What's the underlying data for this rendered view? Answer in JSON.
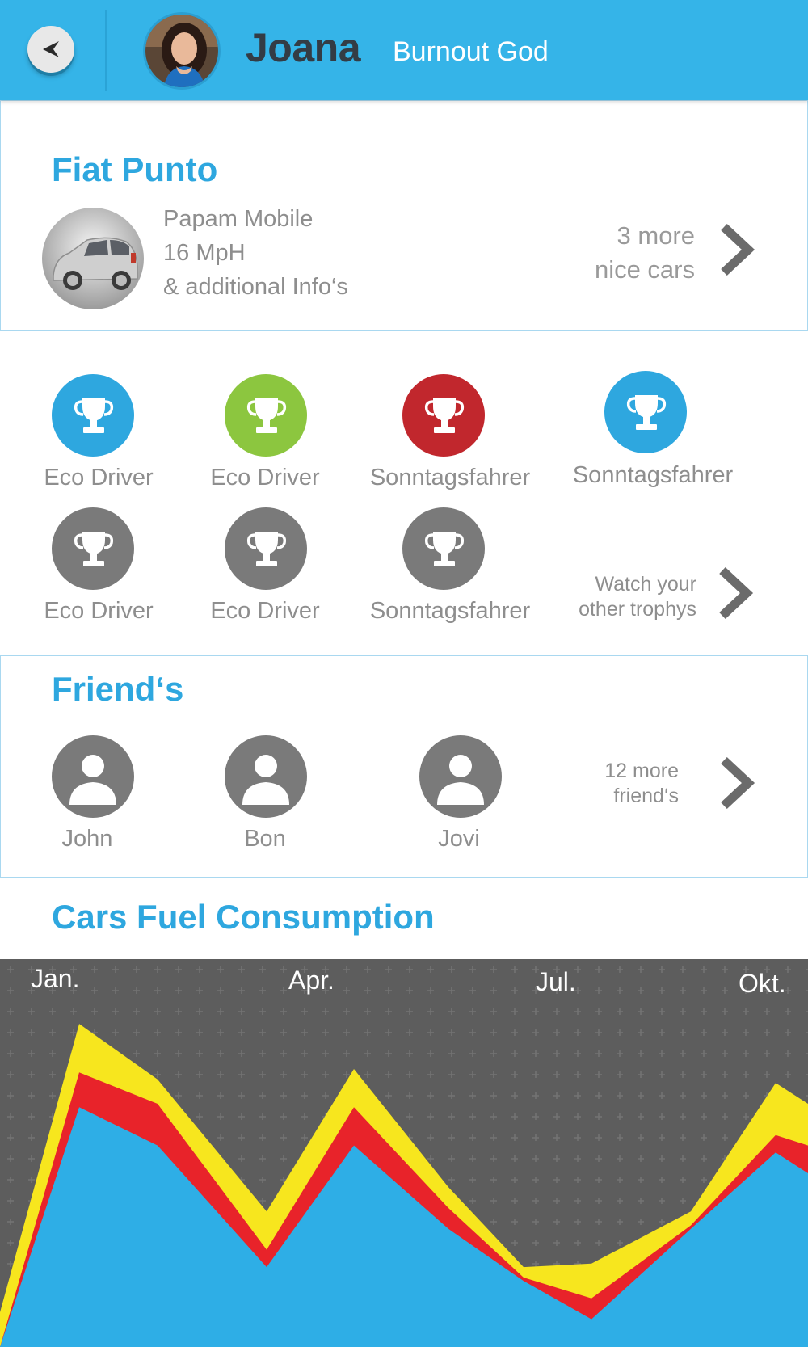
{
  "header": {
    "user_name": "Joana",
    "user_title": "Burnout God",
    "accent_color": "#35b4e8"
  },
  "car": {
    "title": "Fiat Punto",
    "info": [
      "Papam Mobile",
      "16 MpH",
      "& additional Info‘s"
    ],
    "more_line1": "3 more",
    "more_line2": "nice cars"
  },
  "trophies": {
    "items": [
      {
        "label": "Eco Driver",
        "color": "#2ea7df"
      },
      {
        "label": "Eco Driver",
        "color": "#8cc63f"
      },
      {
        "label": "Sonntagsfahrer",
        "color": "#c1272d"
      },
      {
        "label": "Sonntagsfahrer",
        "color": "#2ea7df"
      },
      {
        "label": "Eco Driver",
        "color": "#7a7a7a"
      },
      {
        "label": "Eco Driver",
        "color": "#7a7a7a"
      },
      {
        "label": "Sonntagsfahrer",
        "color": "#7a7a7a"
      }
    ],
    "more_line1": "Watch your",
    "more_line2": "other trophys"
  },
  "friends": {
    "title": "Friend‘s",
    "items": [
      "John",
      "Bon",
      "Jovi"
    ],
    "more_line1": "12 more",
    "more_line2": "friend‘s"
  },
  "fuel": {
    "title": "Cars Fuel Consumption"
  },
  "chart_data": {
    "type": "area",
    "title": "Cars Fuel Consumption",
    "tick_labels": [
      "Jan.",
      "Apr.",
      "Jul.",
      "Okt."
    ],
    "series": [
      {
        "color": "#f7e61e",
        "values": [
          1,
          9.3,
          7.7,
          3.9,
          8.0,
          4.6,
          2.3,
          2.4,
          3.9,
          7.6,
          7.0
        ]
      },
      {
        "color": "#e8232a",
        "values": [
          0,
          7.9,
          7.0,
          2.8,
          6.9,
          4.0,
          2.0,
          1.4,
          3.5,
          6.1,
          5.8
        ]
      },
      {
        "color": "#2eaee6",
        "values": [
          0,
          6.9,
          5.8,
          2.3,
          5.8,
          3.4,
          1.9,
          0.8,
          3.4,
          5.6,
          5.0
        ]
      }
    ],
    "ylim": [
      0,
      10
    ],
    "grid": true,
    "background": "#5d5d5d"
  }
}
